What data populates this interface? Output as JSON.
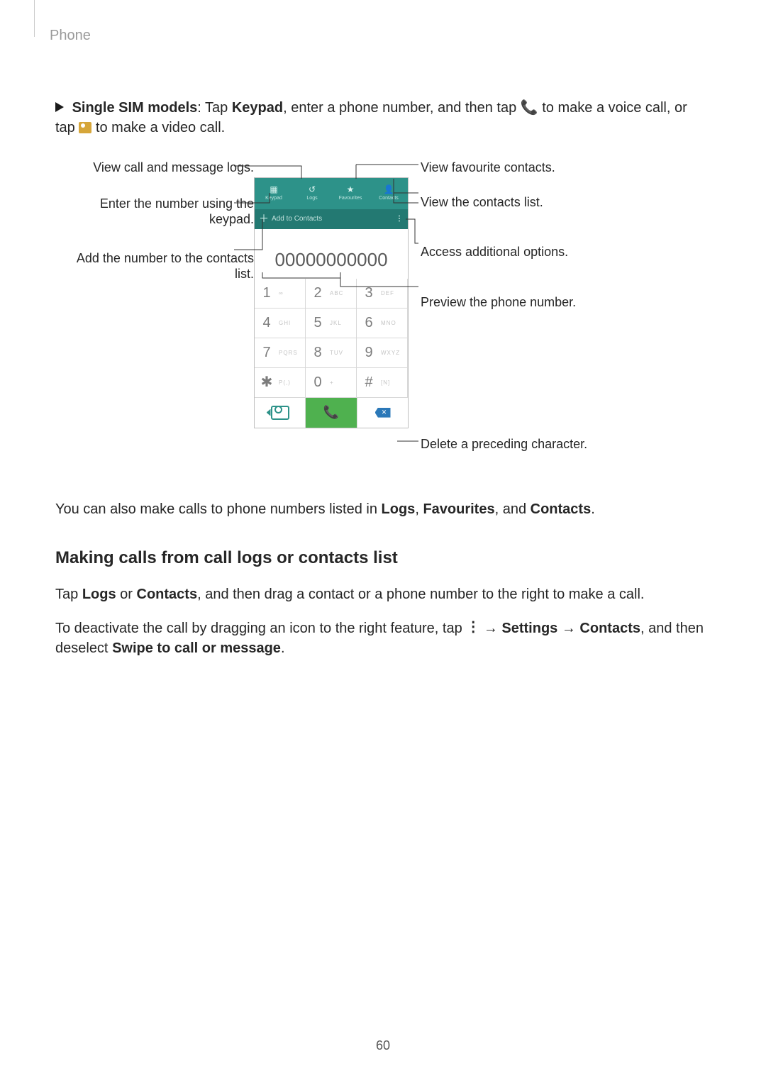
{
  "header": {
    "section": "Phone"
  },
  "intro": {
    "prefix_bold": "Single SIM models",
    "p1_a": ": Tap ",
    "p1_keypad": "Keypad",
    "p1_b": ", enter a phone number, and then tap ",
    "p1_c": " to make a voice call, or tap ",
    "p1_d": " to make a video call."
  },
  "callouts": {
    "left": {
      "logs": "View call and message logs.",
      "enter1": "Enter the number using the",
      "enter2": "keypad.",
      "add1": "Add the number to the contacts",
      "add2": "list."
    },
    "right": {
      "fav": "View favourite contacts.",
      "contacts": "View the contacts list.",
      "options": "Access additional options.",
      "preview": "Preview the phone number.",
      "delete": "Delete a preceding character."
    }
  },
  "phone": {
    "tabs": {
      "keypad": "Keypad",
      "logs": "Logs",
      "fav": "Favourites",
      "contacts": "Contacts"
    },
    "addbar": {
      "label": "Add to Contacts",
      "more": "⋮"
    },
    "number": "00000000000",
    "keys": [
      {
        "d": "1",
        "l": "∞"
      },
      {
        "d": "2",
        "l": "ABC"
      },
      {
        "d": "3",
        "l": "DEF"
      },
      {
        "d": "4",
        "l": "GHI"
      },
      {
        "d": "5",
        "l": "JKL"
      },
      {
        "d": "6",
        "l": "MNO"
      },
      {
        "d": "7",
        "l": "PQRS"
      },
      {
        "d": "8",
        "l": "TUV"
      },
      {
        "d": "9",
        "l": "WXYZ"
      },
      {
        "d": "✱",
        "l": "P(,)"
      },
      {
        "d": "0",
        "l": "+"
      },
      {
        "d": "#",
        "l": "[N]"
      }
    ]
  },
  "body": {
    "p2_a": "You can also make calls to phone numbers listed in ",
    "p2_b": "Logs",
    "p2_c": ", ",
    "p2_d": "Favourites",
    "p2_e": ", and ",
    "p2_f": "Contacts",
    "p2_g": ".",
    "h3": "Making calls from call logs or contacts list",
    "p3_a": "Tap ",
    "p3_b": "Logs",
    "p3_c": " or ",
    "p3_d": "Contacts",
    "p3_e": ", and then drag a contact or a phone number to the right to make a call.",
    "p4_a": "To deactivate the call by dragging an icon to the right feature, tap ",
    "p4_b": " → ",
    "p4_c": "Settings",
    "p4_d": " → ",
    "p4_e": "Contacts",
    "p4_f": ", and then deselect ",
    "p4_g": "Swipe to call or message",
    "p4_h": "."
  },
  "page_number": "60"
}
